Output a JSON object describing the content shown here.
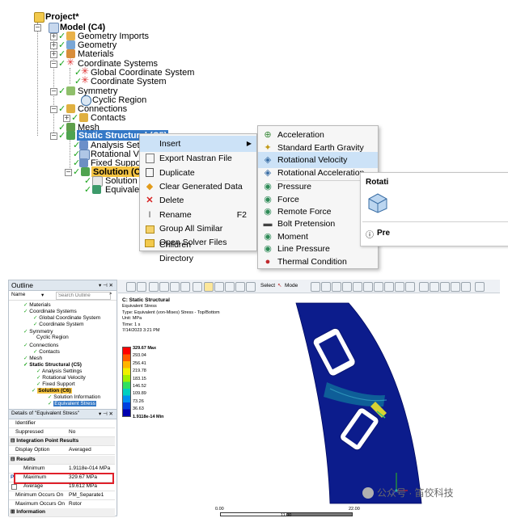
{
  "tree": {
    "project": "Project*",
    "model": "Model (C4)",
    "geometry_imports": "Geometry Imports",
    "geometry": "Geometry",
    "materials": "Materials",
    "coordinate_systems": "Coordinate Systems",
    "global_cs": "Global Coordinate System",
    "coordinate_system": "Coordinate System",
    "symmetry": "Symmetry",
    "cyclic_region": "Cyclic Region",
    "connections": "Connections",
    "contacts": "Contacts",
    "mesh": "Mesh",
    "static_structural": "Static Structural (C5)",
    "analysis_settings": "Analysis Settings",
    "rotational_velocity": "Rotational Velocit",
    "fixed_support": "Fixed Support",
    "solution": "Solution (C6)",
    "solution_info": "Solution Inf",
    "equivalent": "Equivalent S"
  },
  "context_menu": {
    "items": [
      {
        "label": "Insert",
        "icon": "insert-icon"
      },
      {
        "label": "Export Nastran File",
        "icon": "export-icon"
      },
      {
        "label": "Duplicate",
        "icon": "duplicate-icon"
      },
      {
        "label": "Clear Generated Data",
        "icon": "clear-icon"
      },
      {
        "label": "Delete",
        "icon": "delete-icon"
      },
      {
        "label": "Rename",
        "icon": "rename-icon",
        "shortcut": "F2"
      },
      {
        "label": "Group All Similar Children",
        "icon": "group-icon"
      },
      {
        "label": "Open Solver Files Directory",
        "icon": "folder-icon"
      }
    ]
  },
  "submenu": {
    "items": [
      {
        "label": "Acceleration"
      },
      {
        "label": "Standard Earth Gravity"
      },
      {
        "label": "Rotational Velocity"
      },
      {
        "label": "Rotational Acceleration"
      },
      {
        "label": "Pressure"
      },
      {
        "label": "Force"
      },
      {
        "label": "Remote Force"
      },
      {
        "label": "Bolt Pretension"
      },
      {
        "label": "Moment"
      },
      {
        "label": "Line Pressure"
      },
      {
        "label": "Thermal Condition"
      }
    ]
  },
  "tooltip": {
    "title": "Rotati",
    "bottom": "Pre"
  },
  "outline": {
    "title": "Outline",
    "name_label": "Name",
    "search_placeholder": "Search Outline",
    "items": {
      "materials": "Materials",
      "coordinate_systems": "Coordinate Systems",
      "global_cs": "Global Coordinate System",
      "coordinate_system": "Coordinate System",
      "symmetry": "Symmetry",
      "cyclic_region": "Cyclic Region",
      "connections": "Connections",
      "contacts": "Contacts",
      "mesh": "Mesh",
      "static_structural": "Static Structural (C5)",
      "analysis_settings": "Analysis Settings",
      "rotational_velocity": "Rotational Velocity",
      "fixed_support": "Fixed Support",
      "solution": "Solution (C6)",
      "solution_information": "Solution Information",
      "equivalent_stress": "Equivalent Stress"
    }
  },
  "details": {
    "title": "Details of \"Equivalent Stress\"",
    "rows": [
      {
        "k": "Identifier",
        "v": ""
      },
      {
        "k": "Suppressed",
        "v": "No"
      },
      {
        "section": "Integration Point Results"
      },
      {
        "k": "Display Option",
        "v": "Averaged"
      },
      {
        "section": "Results"
      },
      {
        "k": "Minimum",
        "v": "1.9118e-014 MPa"
      },
      {
        "k": "Maximum",
        "v": "329.67 MPa",
        "highlight": true
      },
      {
        "k": "Average",
        "v": "19.612 MPa"
      },
      {
        "k": "Minimum Occurs On",
        "v": "PM_Separate1"
      },
      {
        "k": "Maximum Occurs On",
        "v": "Rotor"
      },
      {
        "section": "Information"
      }
    ]
  },
  "viewport": {
    "toolbar_select": "Select",
    "toolbar_mode": "Mode",
    "header_title": "C: Static Structural",
    "header_lines": [
      "Equivalent Stress",
      "Type: Equivalent (von-Mises) Stress - Top/Bottom",
      "Unit: MPa",
      "Time: 1 s",
      "7/14/2023 3:21 PM"
    ],
    "legend": [
      "329.67 Max",
      "293.04",
      "256.41",
      "219.78",
      "183.15",
      "146.52",
      "109.89",
      "73.26",
      "36.63",
      "1.9118e-14 Min"
    ],
    "legend_colors": [
      "#ff0000",
      "#ff5a00",
      "#ffb400",
      "#f0f000",
      "#a0f000",
      "#30e060",
      "#00d0c0",
      "#0090f0",
      "#0040e0",
      "#0000b0"
    ],
    "scale_left": "0.00",
    "scale_right": "22.00",
    "scale_mid": "11.00"
  },
  "watermark": "公众号 · 笛佼科技"
}
